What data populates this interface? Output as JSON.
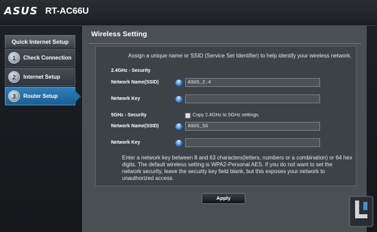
{
  "header": {
    "logo": "ASUS",
    "model": "RT-AC66U"
  },
  "sidebar": {
    "title": "Quick Internet Setup",
    "steps": [
      {
        "num": "1",
        "label": "Check Connection"
      },
      {
        "num": "2",
        "label": "Internet Setup"
      },
      {
        "num": "3",
        "label": "Router Setup",
        "active": true
      }
    ]
  },
  "main": {
    "title": "Wireless Setting",
    "intro": "Assign a unique name or SSID (Service Set Identifier) to help identify your wireless network.",
    "band_24": {
      "heading": "2.4GHz - Security",
      "name_label": "Network Name(SSID)",
      "name_value": "ASUS_2.4",
      "key_label": "Network Key",
      "key_value": ""
    },
    "band_5": {
      "heading": "5GHz - Security",
      "copy_label": "Copy 2.4GHz to 5GHz settings.",
      "name_label": "Network Name(SSID)",
      "name_value": "ASUS_5G",
      "key_label": "Network Key",
      "key_value": ""
    },
    "help_glyph": "?",
    "note": "Enter a network key between 8 and 63 characters(letters, numbers or a combination) or 64 hex digits. The default wireless setting is WPA2-Personal AES. If you do not want to set the network security, leave the security key field blank, but this exposes your network to unauthorized access.",
    "apply_label": "Apply"
  },
  "colors": {
    "accent": "#236ca4",
    "help_icon": "#2a72c6"
  }
}
